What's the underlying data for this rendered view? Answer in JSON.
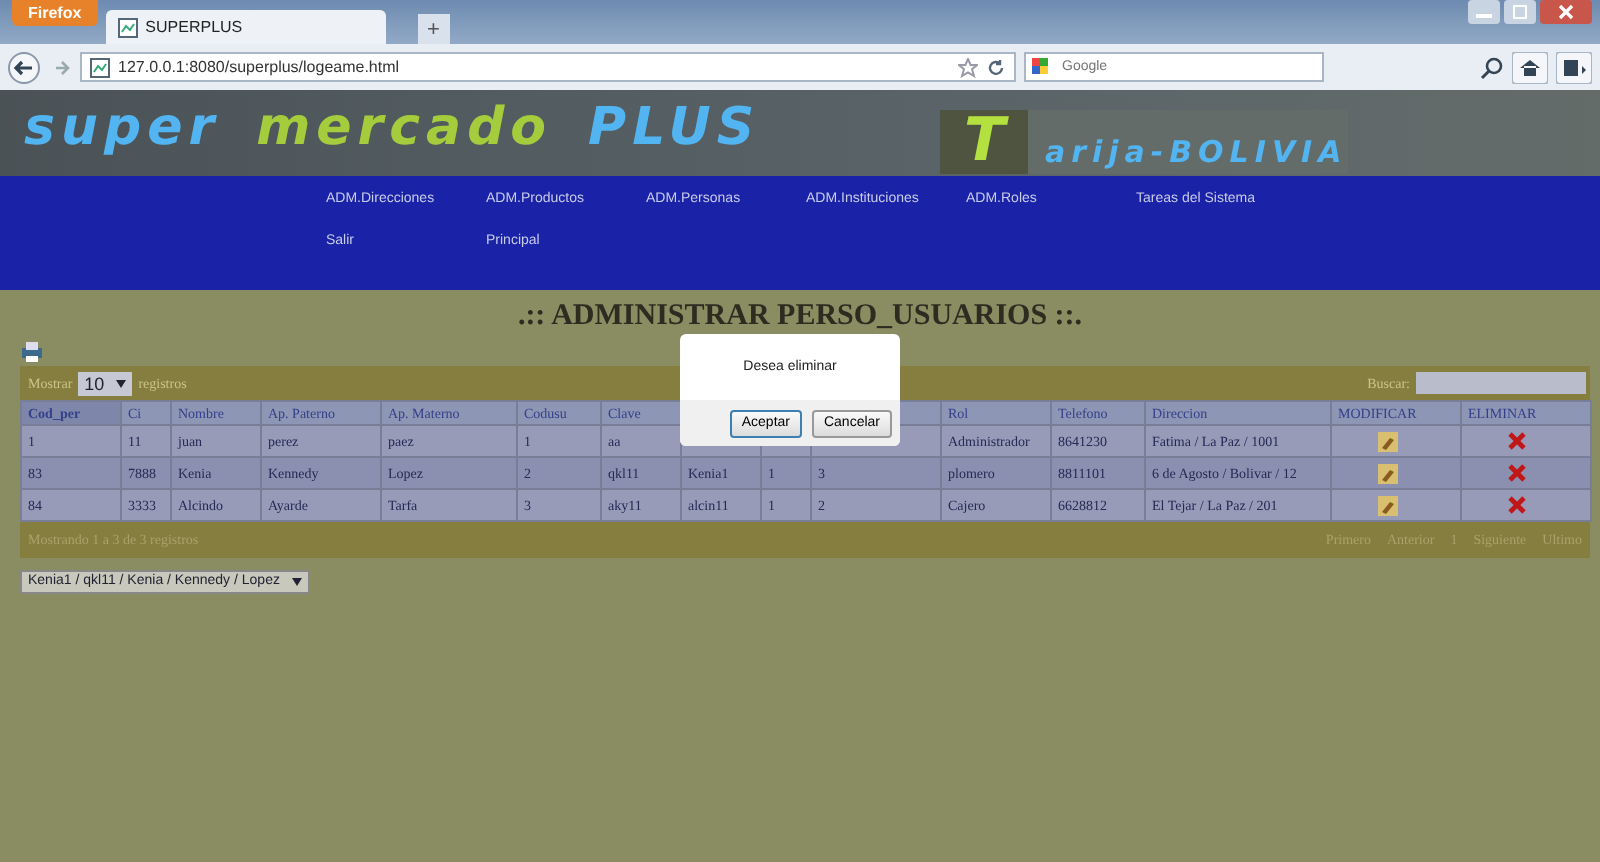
{
  "browser": {
    "menu_button": "Firefox",
    "tab_title": "SUPERPLUS",
    "new_tab": "+",
    "address": "127.0.0.1:8080/superplus/logeame.html",
    "search_placeholder": "Google"
  },
  "banner": {
    "title_words": [
      "super",
      "mercado",
      "PLUS"
    ],
    "region": "arija-BOLIVIA",
    "region_initial": "T"
  },
  "nav": {
    "items": [
      "ADM.Direcciones",
      "ADM.Productos",
      "ADM.Personas",
      "ADM.Instituciones",
      "ADM.Roles",
      "Tareas del Sistema",
      "Salir",
      "Principal"
    ]
  },
  "page_title": ".:: ADMINISTRAR PERSO_USUARIOS ::.",
  "table": {
    "length_label_before": "Mostrar",
    "page_length": "10",
    "length_label_after": "registros",
    "search_label": "Buscar:",
    "columns": [
      {
        "label": "Cod_per",
        "sorted": true
      },
      {
        "label": "Ci",
        "sorted": false
      },
      {
        "label": "Nombre",
        "sorted": false
      },
      {
        "label": "Ap. Paterno",
        "sorted": false
      },
      {
        "label": "Ap. Materno",
        "sorted": false
      },
      {
        "label": "Codusu",
        "sorted": false
      },
      {
        "label": "Clave",
        "sorted": false
      },
      {},
      {},
      {},
      {
        "label": "Rol",
        "sorted": false
      },
      {
        "label": "Telefono",
        "sorted": false
      },
      {
        "label": "Direccion",
        "sorted": false
      },
      {
        "label": "MODIFICAR",
        "sorted": false
      },
      {
        "label": "ELIMINAR",
        "sorted": false
      }
    ],
    "rows": [
      {
        "cells": [
          "1",
          "11",
          "juan",
          "perez",
          "paez",
          "1",
          "aa",
          null,
          null,
          null,
          "Administrador",
          "8641230",
          "Fatima / La Paz / 1001"
        ]
      },
      {
        "cells": [
          "83",
          "7888",
          "Kenia",
          "Kennedy",
          "Lopez",
          "2",
          "qkl11",
          "Kenia1",
          "1",
          "3",
          "plomero",
          "8811101",
          "6 de Agosto / Bolivar / 12"
        ]
      },
      {
        "cells": [
          "84",
          "3333",
          "Alcindo",
          "Ayarde",
          "Tarfa",
          "3",
          "aky11",
          "alcin11",
          "1",
          "2",
          "Cajero",
          "6628812",
          "El Tejar / La Paz / 201"
        ]
      }
    ],
    "info": "Mostrando 1 a 3 de 3 registros",
    "pagination": [
      "Primero",
      "Anterior",
      "1",
      "Siguiente",
      "Ultimo"
    ]
  },
  "selection": {
    "value": "Kenia1 / qkl11 / Kenia / Kennedy / Lopez"
  },
  "dialog": {
    "message": "Desea eliminar",
    "buttons": [
      "Aceptar",
      "Cancelar"
    ]
  }
}
